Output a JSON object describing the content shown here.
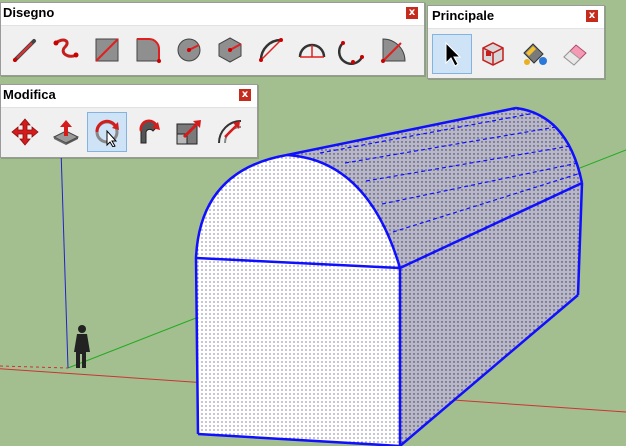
{
  "toolbars": {
    "disegno": {
      "title": "Disegno",
      "close": "x",
      "tools": [
        "line-tool",
        "freehand-tool",
        "rectangle-tool",
        "rotated-rectangle-tool",
        "circle-tool",
        "polygon-tool",
        "arc-tool",
        "2point-arc-tool",
        "3point-arc-tool",
        "pie-tool"
      ]
    },
    "principale": {
      "title": "Principale",
      "close": "x",
      "tools": [
        "select-tool",
        "component-tool",
        "paint-bucket-tool",
        "eraser-tool"
      ],
      "active": "select-tool"
    },
    "modifica": {
      "title": "Modifica",
      "close": "x",
      "tools": [
        "move-tool",
        "push-pull-tool",
        "rotate-tool",
        "follow-me-tool",
        "scale-tool",
        "offset-tool"
      ],
      "active": "rotate-tool"
    }
  },
  "colors": {
    "background": "#a3bf8f",
    "axis_red": "#cc3333",
    "axis_green": "#22aa22",
    "axis_blue": "#2222cc",
    "selection": "#1010ff",
    "close_button": "#c42b1c"
  }
}
